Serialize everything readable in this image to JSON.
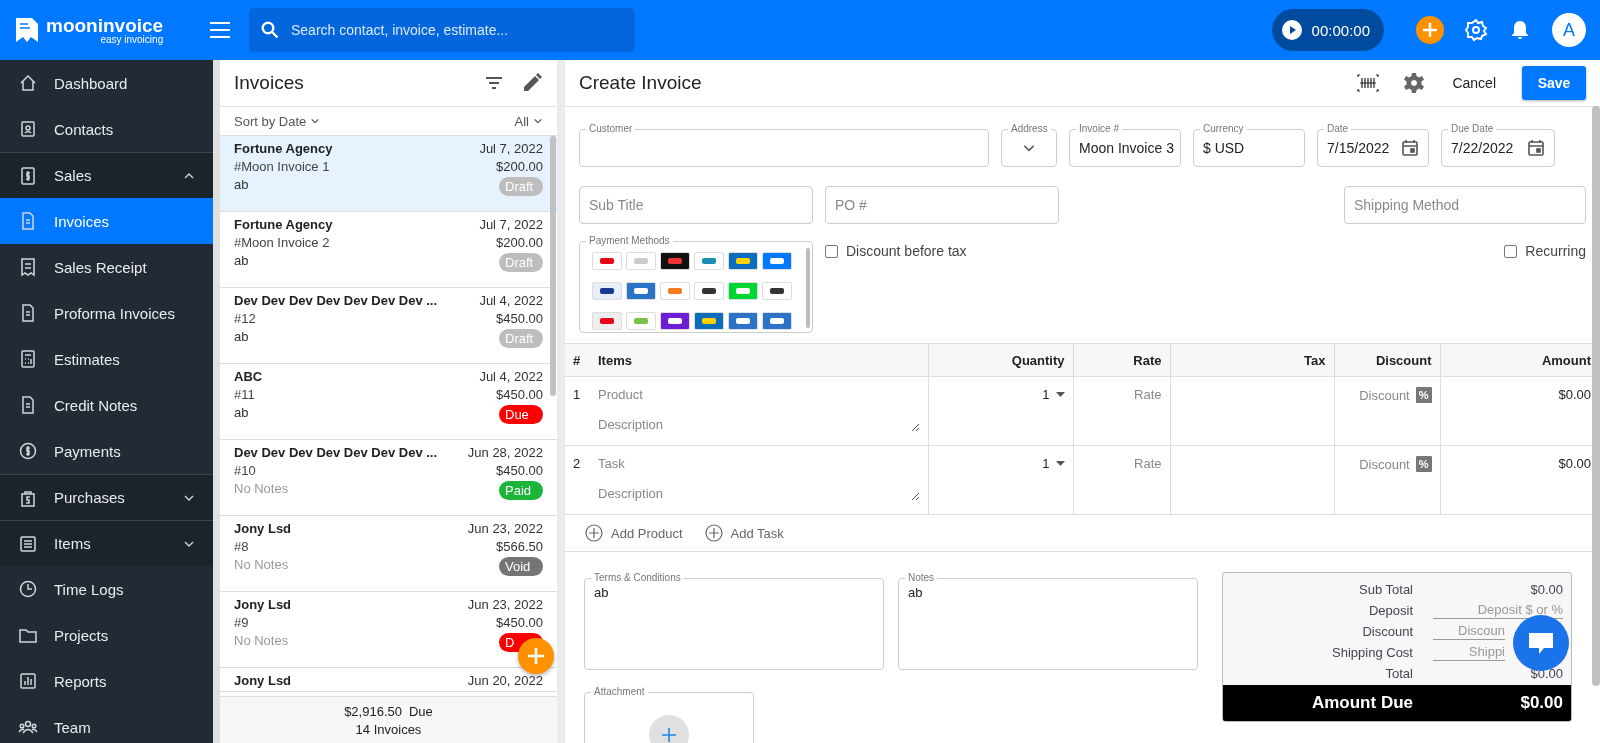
{
  "header": {
    "logo": {
      "name": "mooninvoice",
      "tagline": "easy invoicing"
    },
    "search": {
      "placeholder": "Search contact, invoice, estimate..."
    },
    "timer": "00:00:00",
    "avatar": "A"
  },
  "sidebar": {
    "items": [
      {
        "label": "Dashboard",
        "kind": "link",
        "selected": false
      },
      {
        "label": "Contacts",
        "kind": "link",
        "selected": false
      },
      {
        "label": "Sales",
        "kind": "group",
        "expanded": true,
        "selected": false,
        "children": [
          {
            "label": "Invoices",
            "kind": "link",
            "selected": true
          },
          {
            "label": "Sales Receipt",
            "kind": "link",
            "selected": false
          },
          {
            "label": "Proforma Invoices",
            "kind": "link",
            "selected": false
          },
          {
            "label": "Estimates",
            "kind": "link",
            "selected": false
          },
          {
            "label": "Credit Notes",
            "kind": "link",
            "selected": false
          },
          {
            "label": "Payments",
            "kind": "link",
            "selected": false
          }
        ]
      },
      {
        "label": "Purchases",
        "kind": "group",
        "expanded": false,
        "selected": false
      },
      {
        "label": "Items",
        "kind": "group",
        "expanded": false,
        "selected": false
      },
      {
        "label": "Time Logs",
        "kind": "link",
        "selected": false
      },
      {
        "label": "Projects",
        "kind": "link",
        "selected": false
      },
      {
        "label": "Reports",
        "kind": "link",
        "selected": false
      },
      {
        "label": "Team",
        "kind": "link",
        "selected": false
      }
    ]
  },
  "invoice_list": {
    "title": "Invoices",
    "sort": "Sort by Date",
    "filter": "All",
    "invoices": [
      {
        "name": "Fortune Agency",
        "date": "Jul 7, 2022",
        "number": "#Moon Invoice 1",
        "amount": "$200.00",
        "notes": "ab",
        "notes_placeholder": false,
        "status": "Draft",
        "color": "#bdbdbd",
        "selected": true
      },
      {
        "name": "Fortune Agency",
        "date": "Jul 7, 2022",
        "number": "#Moon Invoice 2",
        "amount": "$200.00",
        "notes": "ab",
        "notes_placeholder": false,
        "status": "Draft",
        "color": "#bdbdbd",
        "selected": false
      },
      {
        "name": "Dev Dev Dev Dev Dev Dev Dev ...",
        "date": "Jul 4, 2022",
        "number": "#12",
        "amount": "$450.00",
        "notes": "ab",
        "notes_placeholder": false,
        "status": "Draft",
        "color": "#bdbdbd",
        "selected": false
      },
      {
        "name": "ABC",
        "date": "Jul 4, 2022",
        "number": "#11",
        "amount": "$450.00",
        "notes": "ab",
        "notes_placeholder": false,
        "status": "Due",
        "color": "#ff0000",
        "selected": false
      },
      {
        "name": "Dev Dev Dev Dev Dev Dev Dev ...",
        "date": "Jun 28, 2022",
        "number": "#10",
        "amount": "$450.00",
        "notes": "No Notes",
        "notes_placeholder": true,
        "status": "Paid",
        "color": "#1db43a",
        "selected": false
      },
      {
        "name": "Jony Lsd",
        "date": "Jun 23, 2022",
        "number": "#8",
        "amount": "$566.50",
        "notes": "No Notes",
        "notes_placeholder": true,
        "status": "Void",
        "color": "#757575",
        "selected": false
      },
      {
        "name": "Jony Lsd",
        "date": "Jun 23, 2022",
        "number": "#9",
        "amount": "$450.00",
        "notes": "No Notes",
        "notes_placeholder": true,
        "status": "D",
        "color": "#ff0000",
        "selected": false
      },
      {
        "name": "Jony Lsd",
        "date": "Jun 20, 2022",
        "selected": false
      }
    ],
    "footer": {
      "total": "$2,916.50",
      "total_label": "Due",
      "count": "14 Invoices"
    }
  },
  "editor": {
    "title": "Create Invoice",
    "cancel": "Cancel",
    "save": "Save",
    "fields": [
      {
        "label": "Customer"
      },
      {
        "label": "Address",
        "kind": "select"
      },
      {
        "label": "Invoice #",
        "value": "Moon Invoice 3"
      },
      {
        "label": "Currency",
        "value": "$ USD"
      },
      {
        "label": "Date",
        "value": "7/15/2022",
        "kind": "date"
      },
      {
        "label": "Due Date",
        "value": "7/22/2022",
        "kind": "date"
      }
    ],
    "sub_title": {
      "placeholder": "Sub Title"
    },
    "po": {
      "placeholder": "PO #"
    },
    "shipping": {
      "placeholder": "Shipping Method"
    },
    "payment_methods": {
      "label": "Payment Methods"
    },
    "discount_before_tax": {
      "label": "Discount before tax",
      "checked": false
    },
    "recurring": {
      "label": "Recurring",
      "checked": false
    },
    "table": {
      "columns": [
        "#",
        "Items",
        "Quantity",
        "Rate",
        "Tax",
        "Discount",
        "Amount"
      ],
      "rows": [
        {
          "number": "1",
          "item": "Product",
          "description": "Description",
          "quantity": "1",
          "rate": "Rate",
          "discount": "Discount",
          "unit": "%",
          "amount": "$0.00"
        },
        {
          "number": "2",
          "item": "Task",
          "description": "Description",
          "quantity": "1",
          "rate": "Rate",
          "discount": "Discount",
          "unit": "%",
          "amount": "$0.00"
        }
      ]
    },
    "add_links": [
      "Add Product",
      "Add Task"
    ],
    "terms": {
      "label": "Terms & Conditions",
      "value": "ab"
    },
    "notes": {
      "label": "Notes",
      "value": "ab"
    },
    "attachment": {
      "label": "Attachment"
    },
    "summary": {
      "rows": [
        {
          "label": "Sub Total",
          "kind": "value",
          "value": "$0.00"
        },
        {
          "label": "Deposit",
          "kind": "input",
          "placeholder": "Deposit $ or %"
        },
        {
          "label": "Discount",
          "kind": "input",
          "placeholder": "Discoun"
        },
        {
          "label": "Shipping Cost",
          "kind": "input",
          "placeholder": "Shippi"
        },
        {
          "label": "Total",
          "kind": "value",
          "value": "$0.00"
        }
      ],
      "amount_due": {
        "label": "Amount Due",
        "value": "$0.00"
      }
    }
  }
}
